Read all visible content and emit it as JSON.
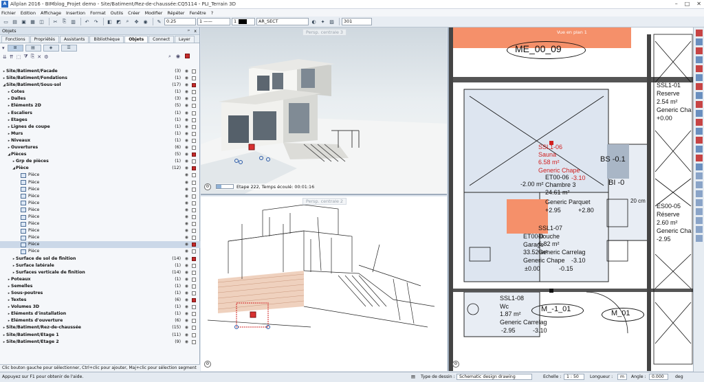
{
  "window": {
    "title": "Allplan 2016 - BIMblog_Projet demo - Site/Batiment/Rez-de-chaussée:CQ5114 - PLI_Terrain 3D",
    "controls": [
      "–",
      "□",
      "✕"
    ]
  },
  "menu": [
    "Fichier",
    "Edition",
    "Affichage",
    "Insertion",
    "Format",
    "Outils",
    "Créer",
    "Modifier",
    "Répéter",
    "Fenêtre",
    "?"
  ],
  "toolbar": {
    "pen_value": "0.25",
    "line_value": "1",
    "color_value": "1",
    "layer_value": "AR_SECT",
    "hatch_value": "301"
  },
  "panel": {
    "title": "Objets",
    "pin": "ᵖ",
    "close": "x",
    "tabs": [
      "Fonctions",
      "Propriétés",
      "Assistants",
      "Bibliothèque",
      "Objets",
      "Connect",
      "Layer"
    ],
    "active_tab": "Objets",
    "status": "Clic bouton gauche pour sélectionner, Ctrl+clic pour ajouter, Maj+clic pour sélection segment"
  },
  "tree": [
    {
      "label": "Site/Batiment/Facade",
      "count": "(3)",
      "level": 0,
      "arrow": "▸",
      "bold": true
    },
    {
      "label": "Site/Batiment/Fondations",
      "count": "(1)",
      "level": 0,
      "arrow": "▸",
      "bold": true
    },
    {
      "label": "Site/Batiment/Sous-sol",
      "count": "(17)",
      "level": 0,
      "arrow": "◢",
      "bold": true,
      "red": true
    },
    {
      "label": "Cotes",
      "count": "(1)",
      "level": 1,
      "arrow": "▸",
      "bold": true
    },
    {
      "label": "Dalles",
      "count": "(3)",
      "level": 1,
      "arrow": "▸",
      "bold": true
    },
    {
      "label": "Eléments 2D",
      "count": "(5)",
      "level": 1,
      "arrow": "▸",
      "bold": true
    },
    {
      "label": "Escaliers",
      "count": "(1)",
      "level": 1,
      "arrow": "▸",
      "bold": true
    },
    {
      "label": "Etages",
      "count": "(1)",
      "level": 1,
      "arrow": "▸",
      "bold": true
    },
    {
      "label": "Lignes de coupe",
      "count": "(1)",
      "level": 1,
      "arrow": "▸",
      "bold": true
    },
    {
      "label": "Murs",
      "count": "(1)",
      "level": 1,
      "arrow": "▸",
      "bold": true
    },
    {
      "label": "Niveaux",
      "count": "(1)",
      "level": 1,
      "arrow": "▸",
      "bold": true
    },
    {
      "label": "Ouvertures",
      "count": "(6)",
      "level": 1,
      "arrow": "▸",
      "bold": true
    },
    {
      "label": "Pièces",
      "count": "(5)",
      "level": 1,
      "arrow": "◢",
      "bold": true,
      "red": true
    },
    {
      "label": "Grp de pièces",
      "count": "(1)",
      "level": 2,
      "arrow": "▸",
      "bold": true
    },
    {
      "label": "Pièce",
      "count": "(12)",
      "level": 2,
      "arrow": "◢",
      "bold": true,
      "red": true
    },
    {
      "label": "Pièce",
      "count": "",
      "level": 3,
      "arrow": "",
      "bold": false,
      "icon": true
    },
    {
      "label": "Pièce",
      "count": "",
      "level": 3,
      "arrow": "",
      "bold": false,
      "icon": true
    },
    {
      "label": "Pièce",
      "count": "",
      "level": 3,
      "arrow": "",
      "bold": false,
      "icon": true
    },
    {
      "label": "Pièce",
      "count": "",
      "level": 3,
      "arrow": "",
      "bold": false,
      "icon": true
    },
    {
      "label": "Pièce",
      "count": "",
      "level": 3,
      "arrow": "",
      "bold": false,
      "icon": true
    },
    {
      "label": "Pièce",
      "count": "",
      "level": 3,
      "arrow": "",
      "bold": false,
      "icon": true
    },
    {
      "label": "Pièce",
      "count": "",
      "level": 3,
      "arrow": "",
      "bold": false,
      "icon": true
    },
    {
      "label": "Pièce",
      "count": "",
      "level": 3,
      "arrow": "",
      "bold": false,
      "icon": true
    },
    {
      "label": "Pièce",
      "count": "",
      "level": 3,
      "arrow": "",
      "bold": false,
      "icon": true
    },
    {
      "label": "Pièce",
      "count": "",
      "level": 3,
      "arrow": "",
      "bold": false,
      "icon": true
    },
    {
      "label": "Pièce",
      "count": "",
      "level": 3,
      "arrow": "",
      "bold": false,
      "icon": true,
      "selected": true,
      "red": true
    },
    {
      "label": "Pièce",
      "count": "",
      "level": 3,
      "arrow": "",
      "bold": false,
      "icon": true
    },
    {
      "label": "Surface de sol de finition",
      "count": "(14)",
      "level": 2,
      "arrow": "▸",
      "bold": true,
      "red": true
    },
    {
      "label": "Surface latérale",
      "count": "(1)",
      "level": 2,
      "arrow": "▸",
      "bold": true
    },
    {
      "label": "Surfaces verticale de finition",
      "count": "(14)",
      "level": 2,
      "arrow": "▸",
      "bold": true
    },
    {
      "label": "Poteaux",
      "count": "(1)",
      "level": 1,
      "arrow": "▸",
      "bold": true
    },
    {
      "label": "Semelles",
      "count": "(1)",
      "level": 1,
      "arrow": "▸",
      "bold": true
    },
    {
      "label": "Sous-poutres",
      "count": "(1)",
      "level": 1,
      "arrow": "▸",
      "bold": true
    },
    {
      "label": "Textes",
      "count": "(6)",
      "level": 1,
      "arrow": "▸",
      "bold": true,
      "red": true
    },
    {
      "label": "Volumes 3D",
      "count": "(1)",
      "level": 1,
      "arrow": "▸",
      "bold": true
    },
    {
      "label": "Eléments d'installation",
      "count": "(1)",
      "level": 1,
      "arrow": "▸",
      "bold": true
    },
    {
      "label": "Eléments d'ouverture",
      "count": "(6)",
      "level": 1,
      "arrow": "▸",
      "bold": true
    },
    {
      "label": "Site/Batiment/Rez-de-chaussée",
      "count": "(15)",
      "level": 0,
      "arrow": "▸",
      "bold": true
    },
    {
      "label": "Site/Batiment/Etage 1",
      "count": "(11)",
      "level": 0,
      "arrow": "▸",
      "bold": true
    },
    {
      "label": "Site/Batiment/Etage 2",
      "count": "(9)",
      "level": 0,
      "arrow": "▸",
      "bold": true
    }
  ],
  "viewports": {
    "top_label": "Persp. centrale 3",
    "top_status": "Etape 222, Temps écoulé: 00:01:16",
    "bottom_label": "Persp. centrale 2",
    "plan_label": "Vue en plan 1"
  },
  "plan": {
    "room_tag_top": "ME_00_09",
    "sauna_code": "SSL1-06",
    "sauna_name": "Sauna",
    "sauna_area": "6.58 m²",
    "sauna_finish": "Generic Chape",
    "sauna_level": "-3.10",
    "chambre_code": "ET00-06",
    "chambre_name": "Chambre 3",
    "chambre_area": "24.61 m²",
    "chambre_neg_area": "-2.00 m²",
    "chambre_finish": "Generic Parquet",
    "chambre_level_a": "+2.95",
    "chambre_level_b": "+2.80",
    "douche_code": "SSL1-07",
    "douche_name": "Douche",
    "douche_area": "6.82 m²",
    "douche_finish": "Generic Carrelag",
    "douche_level": "-3.10",
    "garage_code": "ET00-0",
    "garage_name": "Garage",
    "garage_area": "33.52 m²",
    "garage_finish": "Generic Chape",
    "garage_level_a": "±0.00",
    "garage_level_b": "-0.15",
    "wc_code": "SSL1-08",
    "wc_name": "Wc",
    "wc_area": "1.87 m²",
    "wc_finish": "Generic Carrelag",
    "wc_level_a": "-2.95",
    "wc_level_b": "-3.10",
    "tag_bs": "BS -0.1",
    "tag_bi": "BI -0",
    "tag_m1": "M_-1_01",
    "tag_m0": "M_01",
    "right_code_1": "SSL1-01",
    "right_name_1": "Reserve",
    "right_area_1": "2.54 m²",
    "right_finish_1": "Generic Cha",
    "right_level_1": "+0.00",
    "right_code_2": "ES00-05",
    "right_name_2": "Réserve",
    "right_area_2": "2.60 m²",
    "right_finish_2": "Generic Cha",
    "right_level_2": "-2.95",
    "dim_text": "20 cm"
  },
  "statusbar": {
    "help": "Appuyez sur F1 pour obtenir de l'aide.",
    "drawing_type_label": "Type de dessin :",
    "drawing_type": "Schematic design drawing",
    "scale_label": "Echelle :",
    "scale": "1 : 50",
    "length_label": "Longueur :",
    "length_value": "m",
    "angle_label": "Angle :",
    "angle_value": "0.000",
    "unit": "deg"
  },
  "colors": {
    "accent": "#2b6cc4",
    "orange": "#f5906a",
    "plan_blue": "#dde5f0",
    "selection_red": "#d02020"
  }
}
